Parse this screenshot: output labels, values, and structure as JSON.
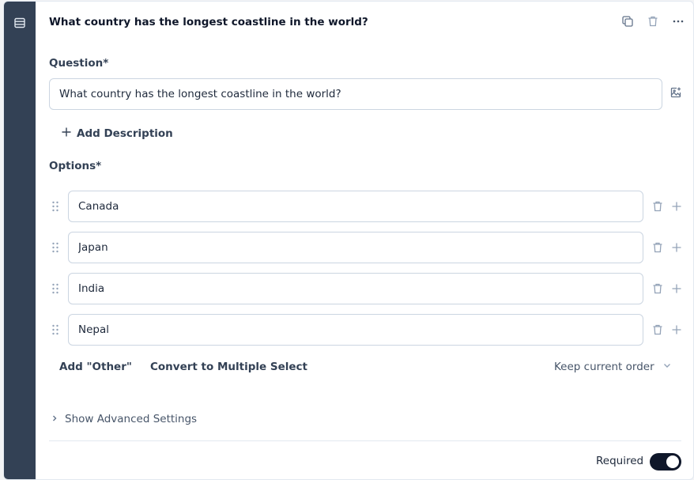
{
  "question_card": {
    "title": "What country has the longest coastline in the world?",
    "question_label": "Question*",
    "question_value": "What country has the longest coastline in the world?",
    "add_description_label": "Add Description",
    "options_label": "Options*",
    "options": [
      {
        "value": "Canada"
      },
      {
        "value": "Japan"
      },
      {
        "value": "India"
      },
      {
        "value": "Nepal"
      }
    ],
    "add_other_label": "Add \"Other\"",
    "convert_label": "Convert to Multiple Select",
    "order_label": "Keep current order",
    "advanced_label": "Show Advanced Settings",
    "required_label": "Required",
    "required_on": true
  },
  "colors": {
    "rail": "#334155",
    "toggle_on": "#0f172a",
    "border": "#cbd5e1"
  },
  "icons": {
    "rail": "list-icon",
    "header": [
      "copy-icon",
      "trash-icon",
      "more-icon"
    ],
    "image": "image-add-icon",
    "option_row": [
      "drag-handle-icon",
      "trash-icon",
      "plus-icon"
    ]
  }
}
